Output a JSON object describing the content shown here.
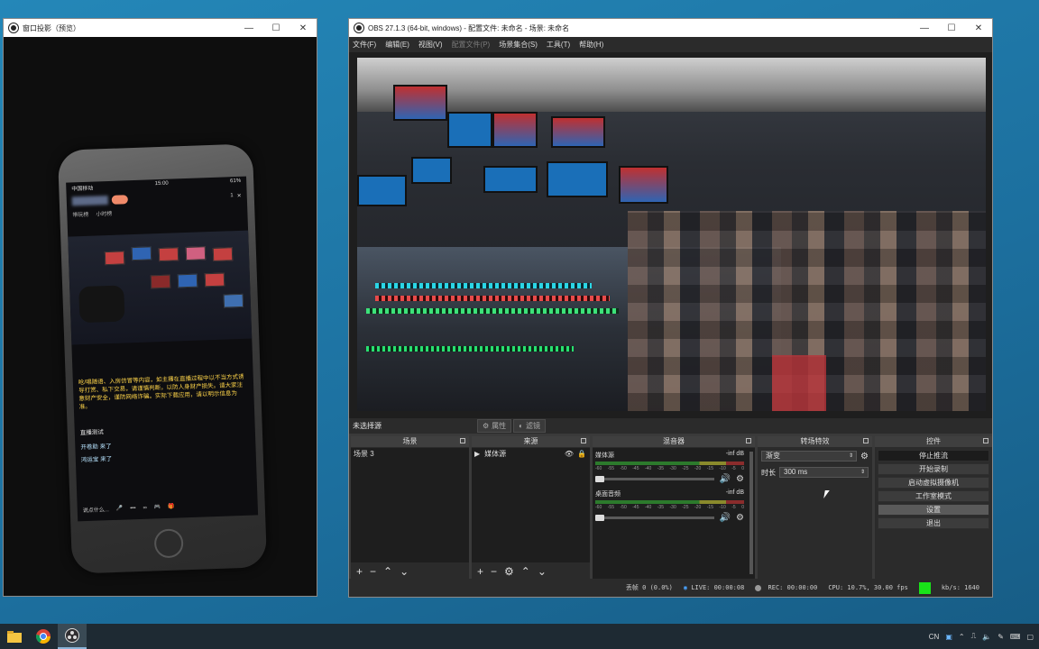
{
  "projector": {
    "title": "窗口投影（预览）",
    "phone": {
      "carrier": "中国移动",
      "time": "15:00",
      "battery": "61%",
      "viewer_count": "1",
      "tag_1": "带玩榜",
      "tag_2": "小时榜",
      "warning": "呛/唱随语、入房仿冒等内容，如主播在直播过程中以不当方式诱导打赏、私下交易，请谨慎判断，以防人身财产损失。请大家注意财产安全，谨防网络诈骗。实际下载应用，请以明示信息为准。",
      "chat": [
        "直播测试",
        "开卷助 来了",
        "鸿运宝 来了"
      ],
      "input_hint": "说点什么..."
    }
  },
  "obs": {
    "title": "OBS 27.1.3 (64-bit, windows) - 配置文件: 未命名 - 场景: 未命名",
    "menu": [
      "文件(F)",
      "编辑(E)",
      "视图(V)",
      "配置文件(P)",
      "场景集合(S)",
      "工具(T)",
      "帮助(H)"
    ],
    "no_source_selected": "未选择源",
    "properties_label": "属性",
    "filters_label": "滤镜",
    "docks": {
      "scenes": {
        "title": "场景",
        "items": [
          "场景 3"
        ]
      },
      "sources": {
        "title": "来源",
        "items": [
          "媒体源"
        ]
      },
      "mixer": {
        "title": "混音器",
        "channels": [
          {
            "name": "媒体源",
            "level": "-inf dB"
          },
          {
            "name": "桌面音频",
            "level": "-inf dB"
          }
        ],
        "ticks": [
          "-60",
          "-55",
          "-50",
          "-45",
          "-40",
          "-35",
          "-30",
          "-25",
          "-20",
          "-15",
          "-10",
          "-5",
          "0"
        ]
      },
      "transitions": {
        "title": "转场特效",
        "selected": "渐变",
        "duration_label": "时长",
        "duration": "300 ms"
      },
      "controls": {
        "title": "控件",
        "buttons": [
          "停止推流",
          "开始录制",
          "启动虚拟摄像机",
          "工作室模式",
          "设置",
          "退出"
        ]
      }
    },
    "status": {
      "dropped": "丢帧 0 (0.0%)",
      "live": "LIVE: 00:00:08",
      "rec": "REC: 00:00:00",
      "cpu": "CPU: 10.7%, 30.00 fps",
      "bitrate": "kb/s: 1640"
    }
  },
  "taskbar": {
    "lang": "CN"
  }
}
